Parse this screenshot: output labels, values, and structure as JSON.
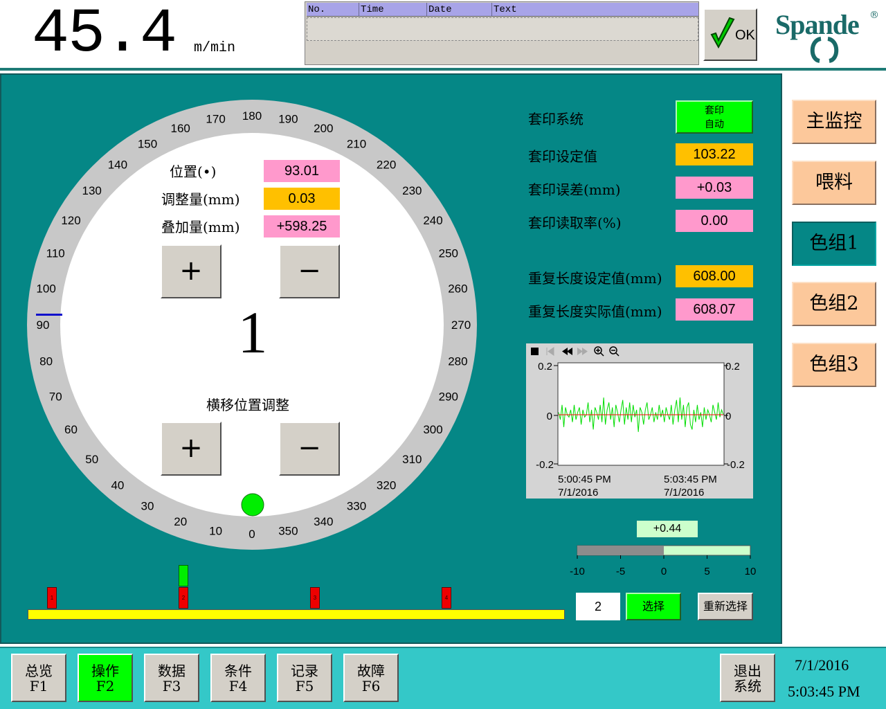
{
  "header": {
    "speed_value": "45.4",
    "speed_unit": "m/min",
    "alarm_table": {
      "columns": [
        "No.",
        "Time",
        "Date",
        "Text"
      ]
    },
    "ack_label": "OK",
    "brand": "Spande",
    "brand_mark": "®"
  },
  "dial": {
    "tick_labels": [
      "0",
      "10",
      "20",
      "30",
      "40",
      "50",
      "60",
      "70",
      "80",
      "90",
      "100",
      "110",
      "120",
      "130",
      "140",
      "150",
      "160",
      "170",
      "180",
      "190",
      "200",
      "210",
      "220",
      "230",
      "240",
      "250",
      "260",
      "270",
      "280",
      "290",
      "300",
      "310",
      "320",
      "330",
      "340",
      "350"
    ],
    "indicator_angle_deg": 90,
    "unit_number": "1",
    "status_dot_color": "#00ee00"
  },
  "position_panel": {
    "position_label": "位置(•)",
    "position_value": "93.01",
    "adjust_label": "调整量(mm)",
    "adjust_value": "0.03",
    "overlay_label": "叠加量(mm)",
    "overlay_value": "+598.25",
    "plus": "+",
    "minus": "−",
    "lateral_title": "横移位置调整"
  },
  "register": {
    "system_label": "套印系统",
    "system_status_line1": "套印",
    "system_status_line2": "自动",
    "setpoint_label": "套印设定值",
    "setpoint_value": "103.22",
    "error_label": "套印误差(mm)",
    "error_value": "+0.03",
    "read_rate_label": "套印读取率(%)",
    "read_rate_value": "0.00",
    "repeat_set_label": "重复长度设定值(mm)",
    "repeat_set_value": "608.00",
    "repeat_actual_label": "重复长度实际值(mm)",
    "repeat_actual_value": "608.07"
  },
  "chart_data": {
    "type": "line",
    "title": "",
    "xlabel": "",
    "ylabel": "",
    "ylim": [
      -0.2,
      0.2
    ],
    "y_ticks_left": [
      "0.2",
      "0",
      "-0.2"
    ],
    "y_ticks_right": [
      "0.2",
      "0",
      "-0.2"
    ],
    "x_ticks": [
      {
        "time": "5:00:45 PM",
        "date": "7/1/2016"
      },
      {
        "time": "5:03:45 PM",
        "date": "7/1/2016"
      }
    ],
    "series": [
      {
        "color": "#00dd00",
        "values": [
          0.01,
          -0.02,
          0.04,
          -0.05,
          0.03,
          0.0,
          -0.01,
          0.02,
          -0.03,
          0.04,
          -0.02,
          0.01,
          0.03,
          -0.04,
          0.02,
          -0.01,
          0.0,
          0.05,
          -0.03,
          0.02,
          -0.06,
          0.03,
          0.01,
          -0.02,
          0.04,
          -0.03,
          0.07,
          -0.04,
          0.02,
          0.05,
          -0.02,
          0.03,
          -0.05,
          0.04,
          0.01,
          -0.03,
          0.02,
          0.06,
          -0.04,
          0.03,
          -0.02,
          0.05,
          -0.03,
          0.04,
          -0.01,
          0.02,
          -0.07,
          0.03,
          0.01,
          -0.04,
          0.02,
          0.05,
          -0.02,
          0.0,
          0.03,
          -0.03,
          0.01,
          -0.02,
          0.04,
          -0.01,
          0.02,
          -0.03,
          0.03,
          0.0,
          -0.02,
          0.04,
          -0.04,
          0.02,
          0.06,
          -0.03,
          0.07,
          -0.02,
          0.04,
          -0.05,
          0.03,
          0.05,
          -0.04,
          -0.06,
          0.02,
          -0.03,
          0.04,
          -0.02,
          0.01,
          -0.05,
          0.03,
          -0.02,
          0.02,
          0.0,
          -0.03,
          0.04,
          0.01,
          -0.02,
          0.05,
          -0.01,
          0.02,
          0.0
        ]
      },
      {
        "color": "#ff0000",
        "values": [
          0,
          0
        ]
      }
    ]
  },
  "error_bar": {
    "value": 0.44,
    "display": "+0.44",
    "range": [
      -10,
      10
    ],
    "ticks": [
      "-10",
      "-5",
      "0",
      "5",
      "10"
    ]
  },
  "unit_track": {
    "markers": [
      "1",
      "2",
      "3",
      "4"
    ],
    "selected": "2"
  },
  "selection": {
    "current": "2",
    "select_label": "选择",
    "reselect_label": "重新选择"
  },
  "side_nav": [
    "主监控",
    "喂料",
    "色组1",
    "色组2",
    "色组3"
  ],
  "bottom_keys": [
    {
      "name": "总览",
      "key": "F1"
    },
    {
      "name": "操作",
      "key": "F2"
    },
    {
      "name": "数据",
      "key": "F3"
    },
    {
      "name": "条件",
      "key": "F4"
    },
    {
      "name": "记录",
      "key": "F5"
    },
    {
      "name": "故障",
      "key": "F6"
    }
  ],
  "exit": {
    "line1": "退出",
    "line2": "系统"
  },
  "clock": {
    "date": "7/1/2016",
    "time": "5:03:45 PM"
  }
}
